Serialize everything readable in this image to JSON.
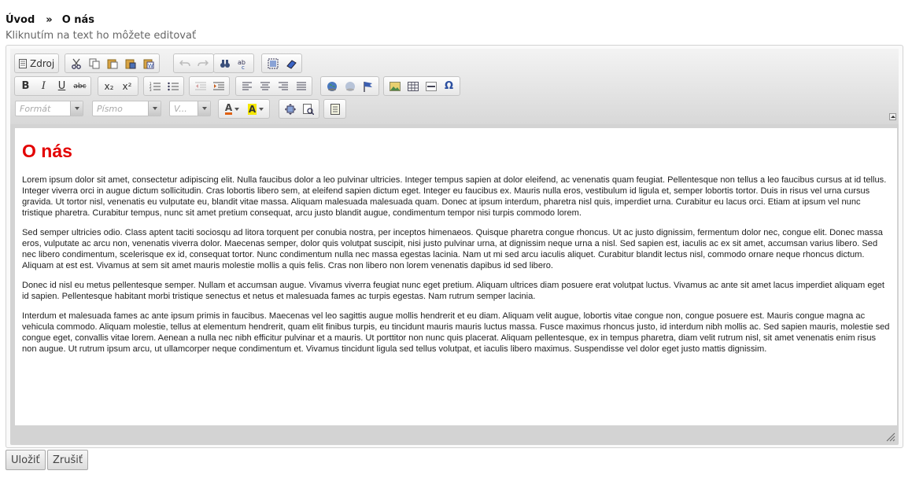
{
  "breadcrumb": {
    "home": "Úvod",
    "separator": "»",
    "current": "O nás"
  },
  "hint": "Kliknutím na text ho môžete editovať",
  "toolbar": {
    "source_label": "Zdroj",
    "format_placeholder": "Formát",
    "font_placeholder": "Písmo",
    "size_placeholder": "V...",
    "subscript": "x₂",
    "superscript": "x²",
    "bold": "B",
    "italic": "I",
    "underline": "U",
    "strike": "abc",
    "omega": "Ω",
    "text_color": "A",
    "bg_color": "A"
  },
  "colors": {
    "heading": "#e30000",
    "bg_highlight": "#f5e700",
    "text_color_icon": "#e06010"
  },
  "content": {
    "heading": "O nás",
    "paragraphs": [
      "Lorem ipsum dolor sit amet, consectetur adipiscing elit. Nulla faucibus dolor a leo pulvinar ultricies. Integer tempus sapien at dolor eleifend, ac venenatis quam feugiat. Pellentesque non tellus a leo faucibus cursus at id tellus. Integer viverra orci in augue dictum sollicitudin. Cras lobortis libero sem, at eleifend sapien dictum eget. Integer eu faucibus ex. Mauris nulla eros, vestibulum id ligula et, semper lobortis tortor. Duis in risus vel urna cursus gravida. Ut tortor nisl, venenatis eu vulputate eu, blandit vitae massa. Aliquam malesuada malesuada quam. Donec at ipsum interdum, pharetra nisl quis, imperdiet urna. Curabitur eu lacus orci. Etiam at ipsum vel nunc tristique pharetra. Curabitur tempus, nunc sit amet pretium consequat, arcu justo blandit augue, condimentum tempor nisi turpis commodo lorem.",
      "Sed semper ultricies odio. Class aptent taciti sociosqu ad litora torquent per conubia nostra, per inceptos himenaeos. Quisque pharetra congue rhoncus. Ut ac justo dignissim, fermentum dolor nec, congue elit. Donec massa eros, vulputate ac arcu non, venenatis viverra dolor. Maecenas semper, dolor quis volutpat suscipit, nisi justo pulvinar urna, at dignissim neque urna a nisl. Sed sapien est, iaculis ac ex sit amet, accumsan varius libero. Sed nec libero condimentum, scelerisque ex id, consequat tortor. Nunc condimentum nulla nec massa egestas lacinia. Nam ut mi sed arcu iaculis aliquet. Curabitur blandit lectus nisl, commodo ornare neque rhoncus dictum. Aliquam at est est. Vivamus at sem sit amet mauris molestie mollis a quis felis. Cras non libero non lorem venenatis dapibus id sed libero.",
      "Donec id nisl eu metus pellentesque semper. Nullam et accumsan augue. Vivamus viverra feugiat nunc eget pretium. Aliquam ultrices diam posuere erat volutpat luctus. Vivamus ac ante sit amet lacus imperdiet aliquam eget id sapien. Pellentesque habitant morbi tristique senectus et netus et malesuada fames ac turpis egestas. Nam rutrum semper lacinia.",
      "Interdum et malesuada fames ac ante ipsum primis in faucibus. Maecenas vel leo sagittis augue mollis hendrerit et eu diam. Aliquam velit augue, lobortis vitae congue non, congue posuere est. Mauris congue magna ac vehicula commodo. Aliquam molestie, tellus at elementum hendrerit, quam elit finibus turpis, eu tincidunt mauris mauris luctus massa. Fusce maximus rhoncus justo, id interdum nibh mollis ac. Sed sapien mauris, molestie sed congue eget, convallis vitae lorem. Aenean a nulla nec nibh efficitur pulvinar et a mauris. Ut porttitor non nunc quis placerat. Aliquam pellentesque, ex in tempus pharetra, diam velit rutrum nisl, sit amet venenatis enim risus non augue. Ut rutrum ipsum arcu, ut ullamcorper neque condimentum et. Vivamus tincidunt ligula sed tellus volutpat, et iaculis libero maximus. Suspendisse vel dolor eget justo mattis dignissim."
    ]
  },
  "buttons": {
    "save": "Uložiť",
    "cancel": "Zrušiť"
  }
}
